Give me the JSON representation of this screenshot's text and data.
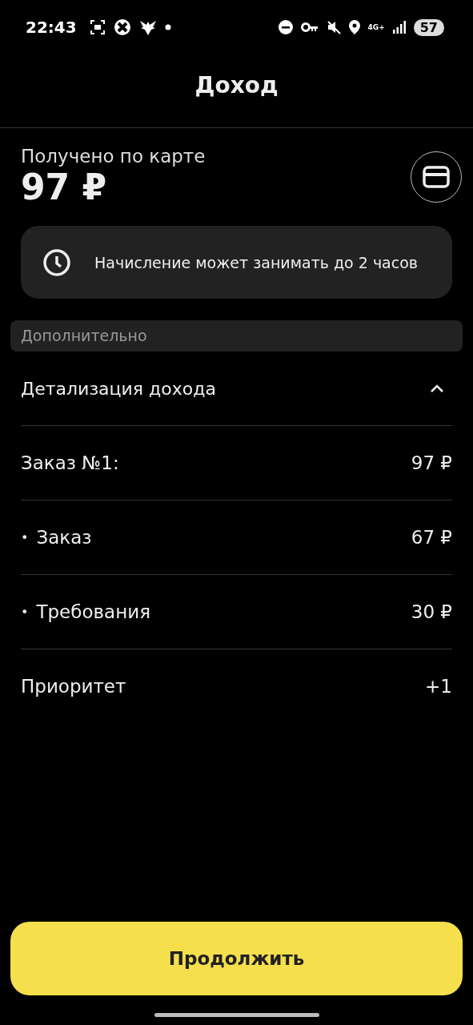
{
  "status_bar": {
    "time": "22:43",
    "network": "4G+",
    "battery": "57"
  },
  "title": "Доход",
  "received": {
    "label": "Получено по карте",
    "amount": "97 ₽"
  },
  "notice": "Начисление может занимать до 2 часов",
  "section_header": "Дополнительно",
  "details": {
    "label": "Детализация дохода",
    "expanded": true
  },
  "rows": [
    {
      "kind": "plain",
      "label": "Заказ №1:",
      "value": "97 ₽"
    },
    {
      "kind": "bullet",
      "bullet": "•",
      "label": "Заказ",
      "value": "67 ₽"
    },
    {
      "kind": "bullet",
      "bullet": "•",
      "label": "Требования",
      "value": "30 ₽"
    },
    {
      "kind": "plain",
      "label": "Приоритет",
      "value": "+1"
    }
  ],
  "continue_button": "Продолжить"
}
